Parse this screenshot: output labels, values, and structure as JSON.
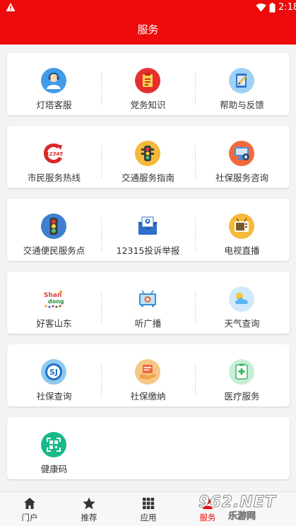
{
  "status_bar": {
    "time": "2:18",
    "icons": [
      "warning-icon",
      "wifi-icon",
      "battery-icon"
    ]
  },
  "header": {
    "title": "服务"
  },
  "services": [
    [
      {
        "label": "灯塔客服",
        "icon": "customer-service-icon"
      },
      {
        "label": "党务知识",
        "icon": "party-knowledge-icon"
      },
      {
        "label": "帮助与反馈",
        "icon": "help-feedback-icon"
      }
    ],
    [
      {
        "label": "市民服务热线",
        "icon": "hotline-12345-icon"
      },
      {
        "label": "交通服务指南",
        "icon": "traffic-light-icon"
      },
      {
        "label": "社保服务咨询",
        "icon": "social-security-consult-icon"
      }
    ],
    [
      {
        "label": "交通便民服务点",
        "icon": "traffic-service-point-icon"
      },
      {
        "label": "12315投诉举报",
        "icon": "complaint-envelope-icon"
      },
      {
        "label": "电视直播",
        "icon": "tv-live-icon"
      }
    ],
    [
      {
        "label": "好客山东",
        "icon": "hospitable-shandong-logo",
        "logo_text": "Shan dong"
      },
      {
        "label": "听广播",
        "icon": "radio-icon"
      },
      {
        "label": "天气查询",
        "icon": "weather-icon"
      }
    ],
    [
      {
        "label": "社保查询",
        "icon": "social-security-query-icon"
      },
      {
        "label": "社保缴纳",
        "icon": "social-security-pay-icon"
      },
      {
        "label": "医疗服务",
        "icon": "medical-service-icon"
      }
    ],
    [
      {
        "label": "健康码",
        "icon": "health-code-icon"
      }
    ]
  ],
  "tabs": [
    {
      "label": "门户",
      "icon": "home-icon",
      "active": false
    },
    {
      "label": "推荐",
      "icon": "star-icon",
      "active": false
    },
    {
      "label": "应用",
      "icon": "grid-icon",
      "active": false
    },
    {
      "label": "服务",
      "icon": "service-icon",
      "active": true
    }
  ],
  "watermark": {
    "text": "962.NET",
    "subtext": "乐游网"
  },
  "colors": {
    "primary": "#ee0a0a",
    "background": "#f3f3f3",
    "card": "#ffffff",
    "text": "#333333"
  }
}
